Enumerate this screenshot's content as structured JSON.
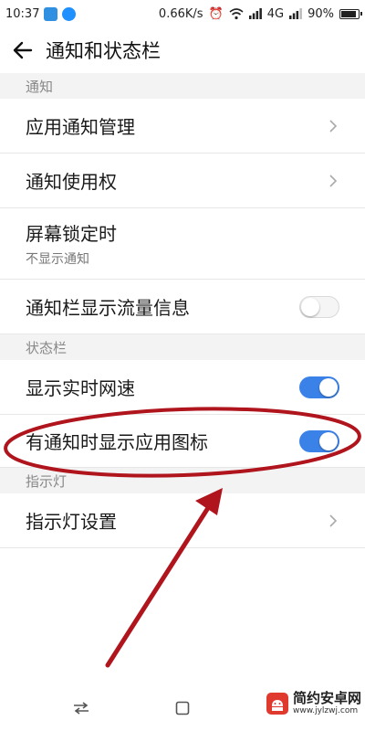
{
  "status_bar": {
    "time": "10:37",
    "network_speed": "0.66K/s",
    "network_type": "4G",
    "battery": "90%"
  },
  "header": {
    "title": "通知和状态栏"
  },
  "sections": {
    "notifications": "通知",
    "status_bar": "状态栏",
    "indicator": "指示灯"
  },
  "rows": {
    "app_notification_mgmt": "应用通知管理",
    "notification_access": "通知使用权",
    "lock_screen": {
      "label": "屏幕锁定时",
      "value": "不显示通知"
    },
    "show_traffic": {
      "label": "通知栏显示流量信息",
      "enabled": false
    },
    "realtime_speed": {
      "label": "显示实时网速",
      "enabled": true
    },
    "notification_icons": {
      "label": "有通知时显示应用图标",
      "enabled": true
    },
    "indicator_settings": "指示灯设置"
  },
  "watermark": {
    "name": "简约安卓网",
    "url": "www.jylzwj.com"
  },
  "colors": {
    "accent": "#3b82e8",
    "annotation": "#b0141c"
  }
}
